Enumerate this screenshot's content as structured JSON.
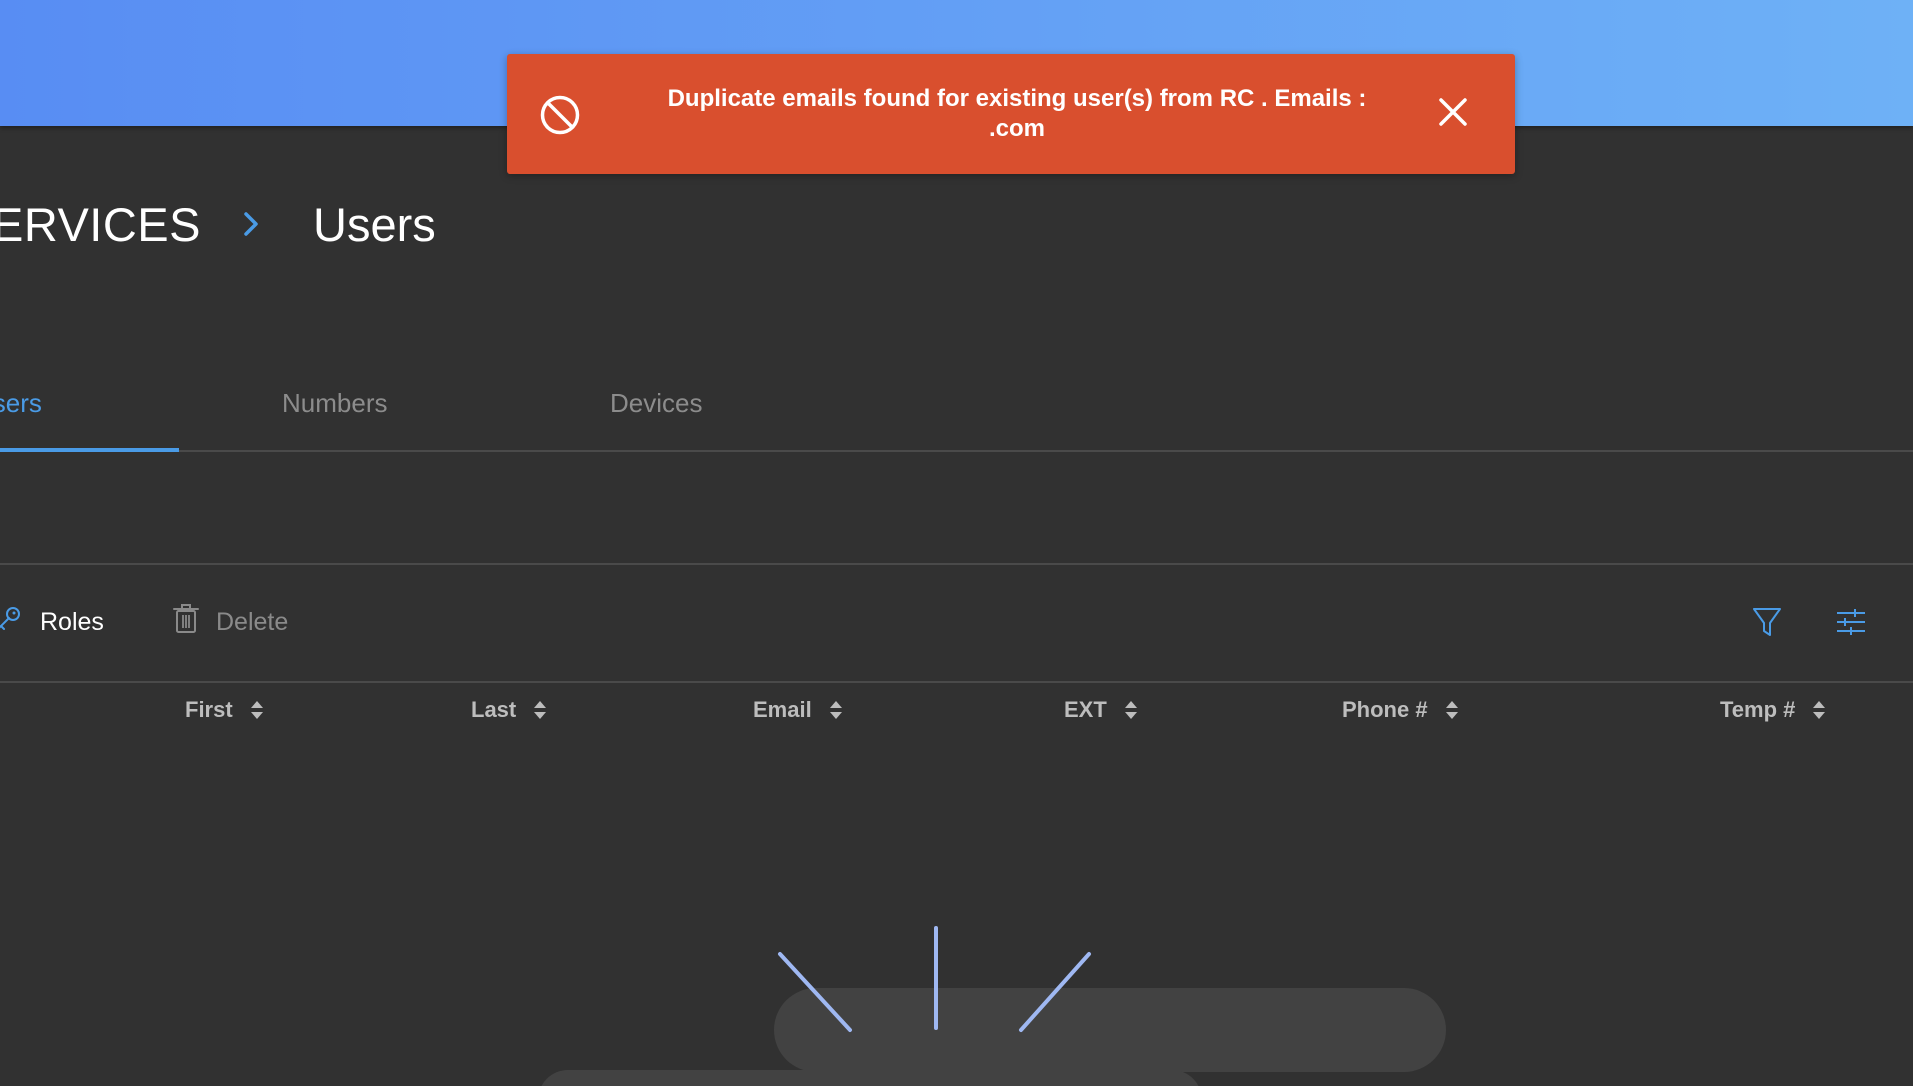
{
  "breadcrumb": {
    "parent": "ERVICES",
    "current": "Users"
  },
  "tabs": [
    {
      "label": "Users",
      "active": true
    },
    {
      "label": "Numbers",
      "active": false
    },
    {
      "label": "Devices",
      "active": false
    }
  ],
  "toolbar": {
    "roles_label": "Roles",
    "delete_label": "Delete",
    "filter_icon": "filter-icon",
    "columns_icon": "sliders-icon"
  },
  "table": {
    "columns": [
      "First",
      "Last",
      "Email",
      "EXT",
      "Phone #",
      "Temp #"
    ]
  },
  "toast": {
    "line1": "Duplicate emails found for existing user(s) from RC . Emails :",
    "line2": ".com",
    "icon": "prohibited-icon",
    "close_icon": "close-icon"
  },
  "colors": {
    "banner_start": "#588df3",
    "banner_end": "#6eb1f6",
    "background": "#313131",
    "accent": "#4a9be6",
    "toast": "#d94f2e"
  }
}
